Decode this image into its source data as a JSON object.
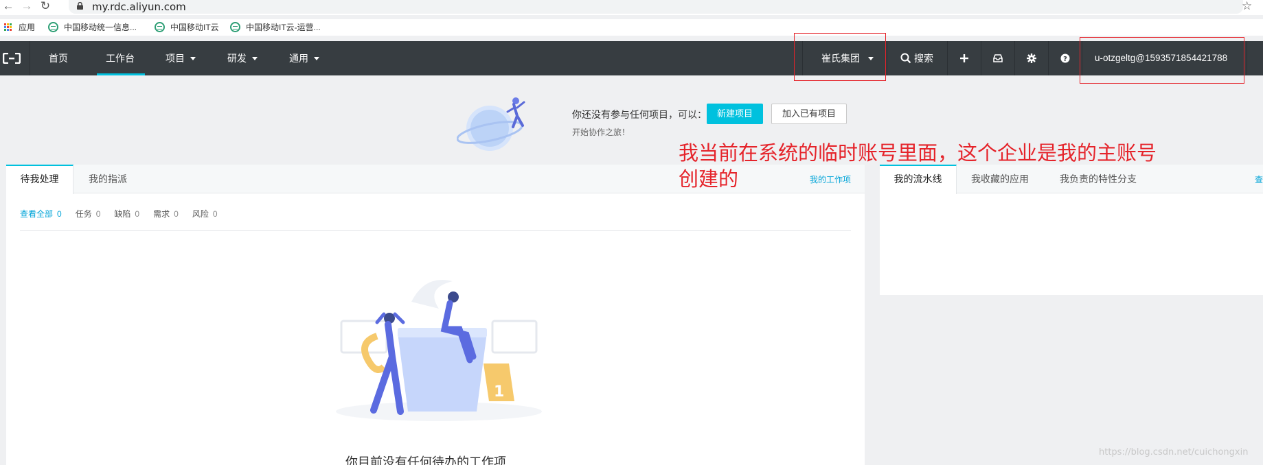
{
  "browser": {
    "url": "my.rdc.aliyun.com",
    "bookmarks": [
      {
        "label": "应用"
      },
      {
        "label": "中国移动统一信息..."
      },
      {
        "label": "中国移动IT云"
      },
      {
        "label": "中国移动IT云-运营..."
      }
    ]
  },
  "navbar": {
    "items": [
      {
        "label": "首页"
      },
      {
        "label": "工作台"
      },
      {
        "label": "项目"
      },
      {
        "label": "研发"
      },
      {
        "label": "通用"
      }
    ],
    "org_label": "崔氏集团",
    "search_label": "搜索",
    "user_label": "u-otzgeltg@1593571854421788"
  },
  "banner": {
    "message": "你还没有参与任何项目，可以：",
    "new_project_label": "新建项目",
    "join_project_label": "加入已有项目",
    "subtitle": "开始协作之旅！"
  },
  "annotation": {
    "line1": "我当前在系统的临时账号里面，这个企业是我的主账号",
    "line2": "创建的"
  },
  "left_panel": {
    "tabs": [
      {
        "label": "待我处理"
      },
      {
        "label": "我的指派"
      }
    ],
    "link_label": "我的工作项",
    "filters": [
      {
        "label": "查看全部",
        "count": "0"
      },
      {
        "label": "任务",
        "count": "0"
      },
      {
        "label": "缺陷",
        "count": "0"
      },
      {
        "label": "需求",
        "count": "0"
      },
      {
        "label": "风险",
        "count": "0"
      }
    ],
    "empty_text": "你目前没有任何待办的工作项"
  },
  "right_panel": {
    "tabs": [
      {
        "label": "我的流水线"
      },
      {
        "label": "我收藏的应用"
      },
      {
        "label": "我负责的特性分支"
      }
    ],
    "link_label": "查"
  },
  "watermark": "https://blog.csdn.net/cuichongxin",
  "colors": {
    "navbar_bg": "#373d41",
    "accent": "#00c1de",
    "link": "#00a4d8",
    "annotation_red": "#e5232a",
    "page_bg": "#eff0f2"
  },
  "icons": [
    "back-arrow-icon",
    "forward-arrow-icon",
    "reload-icon",
    "lock-icon",
    "star-icon",
    "apps-grid-icon",
    "globe-icon",
    "aliyun-logo-icon",
    "search-icon",
    "plus-icon",
    "inbox-icon",
    "gear-icon",
    "help-icon"
  ]
}
